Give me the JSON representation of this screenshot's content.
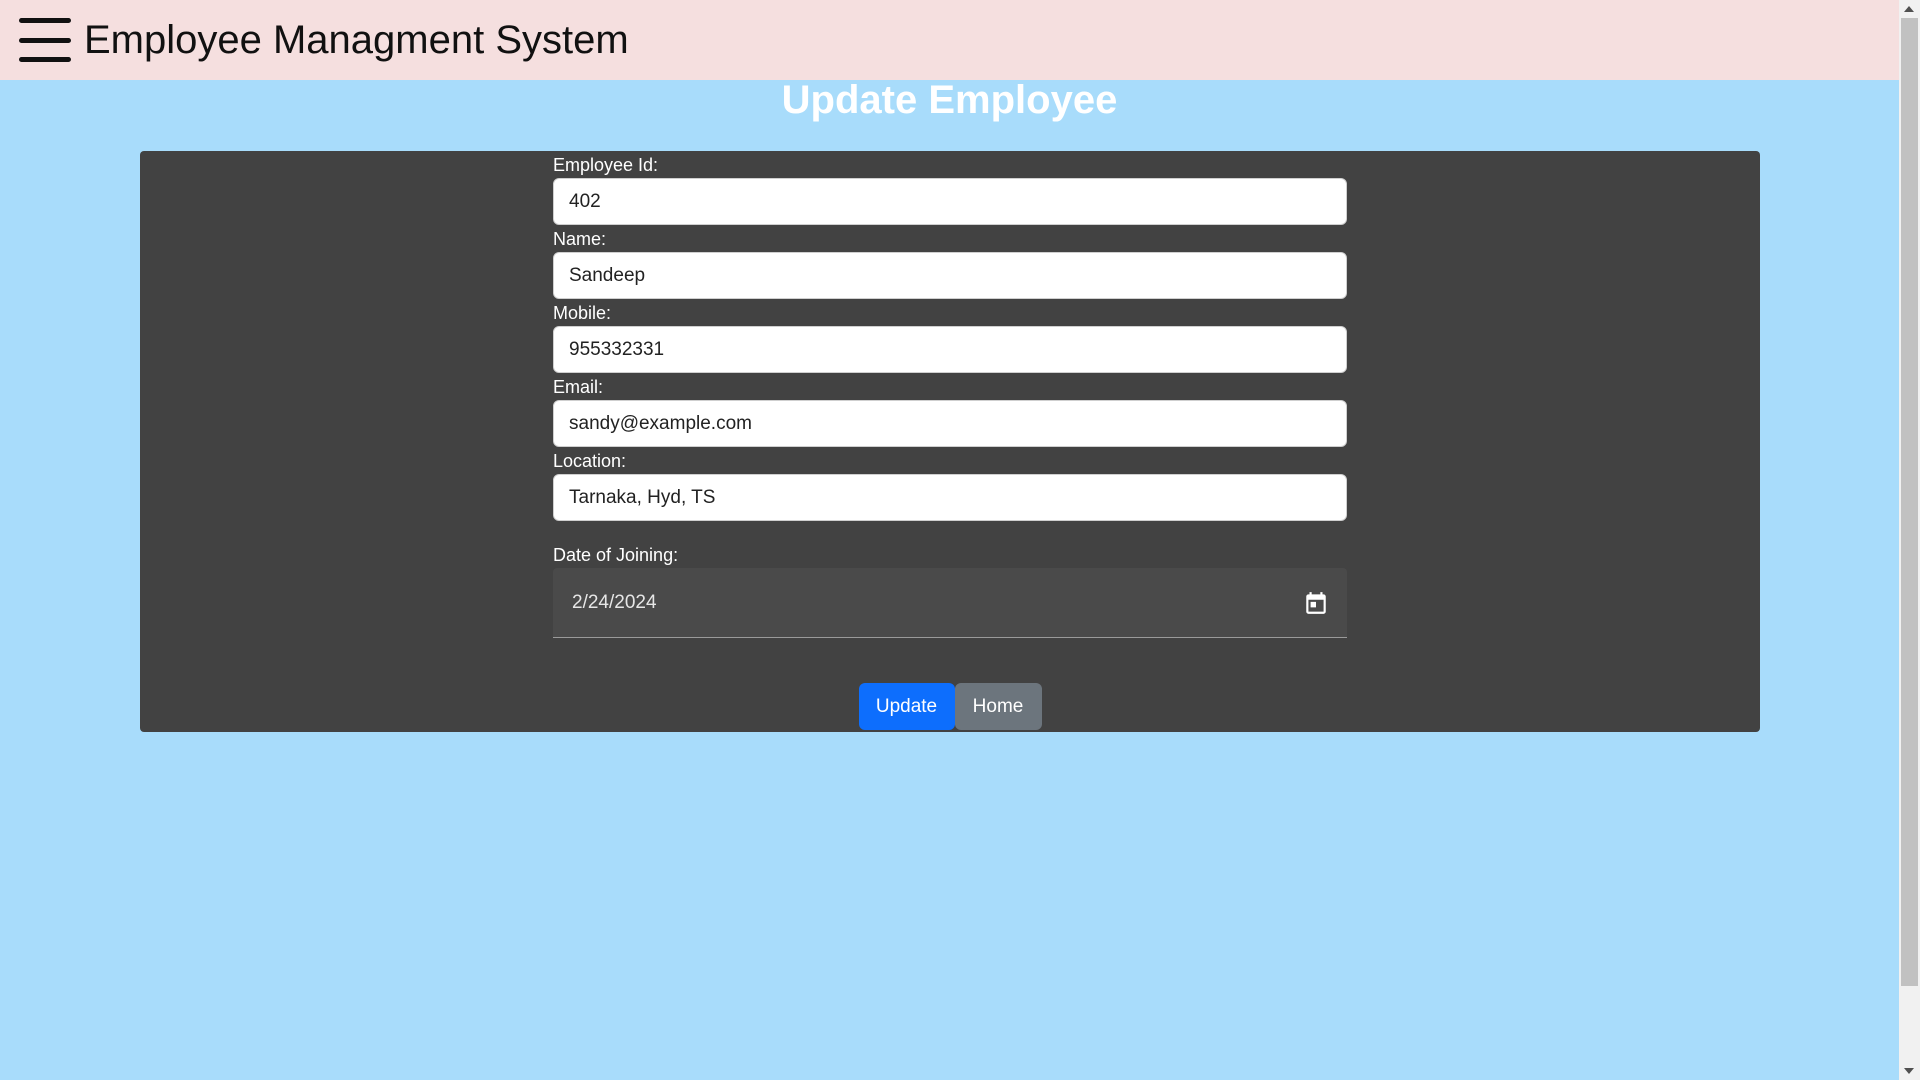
{
  "header": {
    "menu_icon": "hamburger-menu-icon",
    "title": "Employee Managment System",
    "background": "#f5dfdf"
  },
  "page": {
    "heading": "Update Employee",
    "background": "#a8dcfb"
  },
  "form": {
    "employee_id": {
      "label": "Employee Id:",
      "value": "402"
    },
    "name": {
      "label": "Name:",
      "value": "Sandeep"
    },
    "mobile": {
      "label": "Mobile:",
      "value": "955332331"
    },
    "email": {
      "label": "Email:",
      "value": "sandy@example.com"
    },
    "location": {
      "label": "Location:",
      "value": "Tarnaka, Hyd, TS"
    },
    "date_of_joining": {
      "label": "Date of Joining:",
      "value": "2/24/2024",
      "icon": "calendar-icon"
    },
    "panel_color": "#424242"
  },
  "buttons": {
    "update_label": "Update",
    "home_label": "Home",
    "update_color": "#0d6efd",
    "home_color": "#6c757d"
  }
}
